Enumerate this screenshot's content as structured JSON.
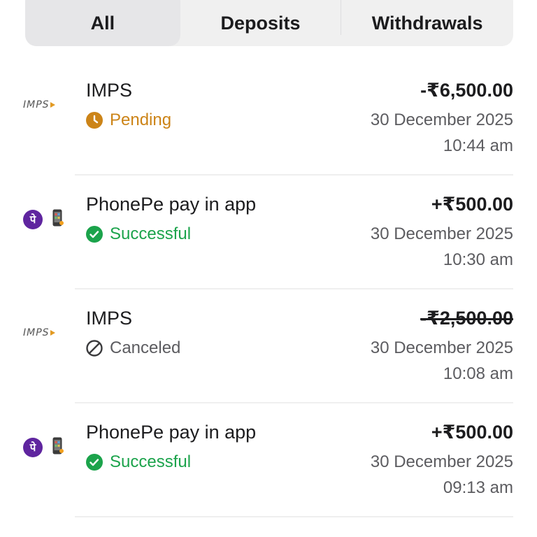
{
  "tabs": [
    {
      "label": "All",
      "active": true
    },
    {
      "label": "Deposits",
      "active": false
    },
    {
      "label": "Withdrawals",
      "active": false
    }
  ],
  "colors": {
    "pending": "#cc8418",
    "successful": "#1ba34b",
    "canceled": "#5c5c60",
    "phonepe": "#5f259f"
  },
  "transactions": [
    {
      "method": "IMPS",
      "logo": "imps-logo",
      "status": "Pending",
      "status_icon": "clock-icon",
      "amount": "-₹6,500.00",
      "struck": false,
      "date": "30 December 2025",
      "time": "10:44 am"
    },
    {
      "method": "PhonePe pay in app",
      "logo": "phonepe-logo",
      "status": "Successful",
      "status_icon": "check-circle-icon",
      "amount": "+₹500.00",
      "struck": false,
      "date": "30 December 2025",
      "time": "10:30 am"
    },
    {
      "method": "IMPS",
      "logo": "imps-logo",
      "status": "Canceled",
      "status_icon": "cancel-icon",
      "amount": "-₹2,500.00",
      "struck": true,
      "date": "30 December 2025",
      "time": "10:08 am"
    },
    {
      "method": "PhonePe pay in app",
      "logo": "phonepe-logo",
      "status": "Successful",
      "status_icon": "check-circle-icon",
      "amount": "+₹500.00",
      "struck": false,
      "date": "30 December 2025",
      "time": "09:13 am"
    }
  ],
  "logo_text": {
    "imps": "IMPS",
    "phonepe": "पे"
  }
}
